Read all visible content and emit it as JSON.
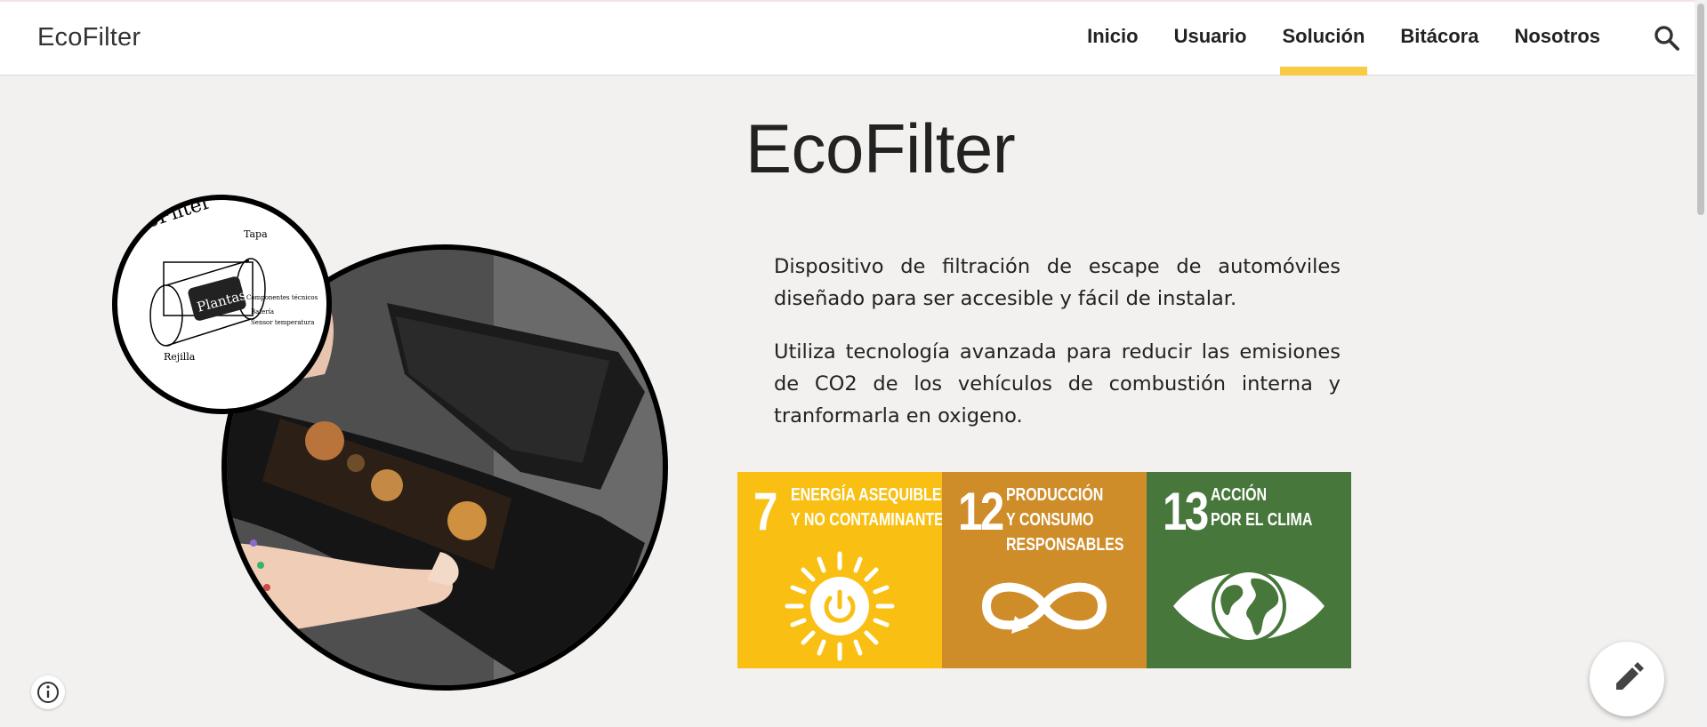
{
  "header": {
    "site_title": "EcoFilter",
    "nav": [
      {
        "label": "Inicio"
      },
      {
        "label": "Usuario"
      },
      {
        "label": "Solución",
        "active": true
      },
      {
        "label": "Bitácora"
      },
      {
        "label": "Nosotros"
      }
    ],
    "search_icon": "search-icon",
    "active_indicator_color": "#f7cb44"
  },
  "main": {
    "heading": "EcoFilter",
    "paragraphs": [
      "Dispositivo de filtración de escape de automóviles diseñado para ser accesible y fácil de instalar.",
      "Utiliza tecnología avanzada para reducir las emisiones de CO2 de los vehículos de combustión interna y tranformarla en oxigeno."
    ],
    "sketch": {
      "brand_text": "EcoFilter",
      "box_label": "Plantas",
      "labels": [
        "Tapa",
        "Componentes técnicos",
        "Batería",
        "Sensor temperatura",
        "Rejilla"
      ]
    },
    "sdg_tiles": [
      {
        "number": "7",
        "line1": "ENERGÍA ASEQUIBLE",
        "line2": "Y NO CONTAMINANTE",
        "line3": "",
        "color": "#f9c013",
        "icon": "sun-power-icon"
      },
      {
        "number": "12",
        "line1": "PRODUCCIÓN",
        "line2": "Y CONSUMO",
        "line3": "RESPONSABLES",
        "color": "#cf8d2a",
        "icon": "infinity-loop-icon"
      },
      {
        "number": "13",
        "line1": "ACCIÓN",
        "line2": "POR EL CLIMA",
        "line3": "",
        "color": "#48773c",
        "icon": "eye-globe-icon"
      }
    ]
  },
  "footer": {
    "info_icon": "info-icon",
    "edit_icon": "pencil-icon"
  }
}
